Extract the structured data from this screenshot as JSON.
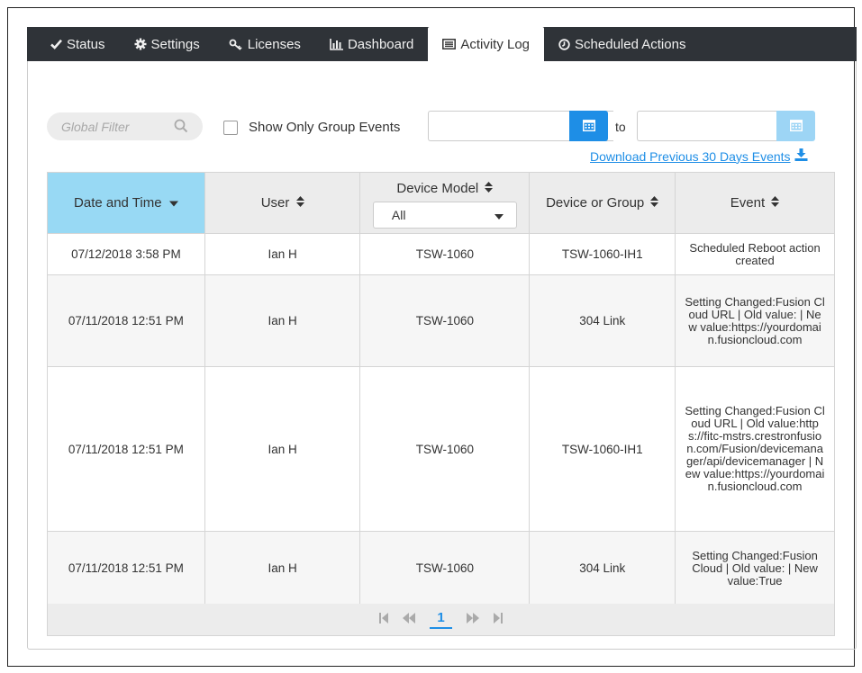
{
  "tabs": [
    {
      "label": "Status",
      "icon": "check-icon"
    },
    {
      "label": "Settings",
      "icon": "gear-icon"
    },
    {
      "label": "Licenses",
      "icon": "key-icon"
    },
    {
      "label": "Dashboard",
      "icon": "bar-chart-icon"
    },
    {
      "label": "Activity Log",
      "icon": "list-icon"
    },
    {
      "label": "Scheduled Actions",
      "icon": "clock-icon"
    }
  ],
  "toolbar": {
    "filter_placeholder": "Global Filter",
    "group_events_label": "Show Only Group Events",
    "to_label": "to",
    "download_label": "Download Previous 30 Days Events"
  },
  "table": {
    "headers": {
      "date": "Date and Time",
      "user": "User",
      "model": "Device Model",
      "device": "Device or Group",
      "event": "Event"
    },
    "model_filter_value": "All",
    "rows": [
      {
        "date": "07/12/2018 3:58 PM",
        "user": "Ian H",
        "model": "TSW-1060",
        "device": "TSW-1060-IH1",
        "event": "Scheduled Reboot action created"
      },
      {
        "date": "07/11/2018 12:51 PM",
        "user": "Ian H",
        "model": "TSW-1060",
        "device": "304 Link",
        "event": "Setting Changed:Fusion Cloud URL | Old value: | New value:https://yourdomain.fusioncloud.com"
      },
      {
        "date": "07/11/2018 12:51 PM",
        "user": "Ian H",
        "model": "TSW-1060",
        "device": "TSW-1060-IH1",
        "event": "Setting Changed:Fusion Cloud URL | Old value:https://fitc-mstrs.crestronfusion.com/Fusion/devicemanager/api/devicemanager | New value:https://yourdomain.fusioncloud.com"
      },
      {
        "date": "07/11/2018 12:51 PM",
        "user": "Ian H",
        "model": "TSW-1060",
        "device": "304 Link",
        "event": "Setting Changed:Fusion Cloud | Old value: | New value:True"
      }
    ]
  },
  "pager": {
    "current_page": "1"
  },
  "colors": {
    "accent": "#1e8ee6",
    "sorted_header": "#98d9f4",
    "tabbar": "#2f3338"
  }
}
